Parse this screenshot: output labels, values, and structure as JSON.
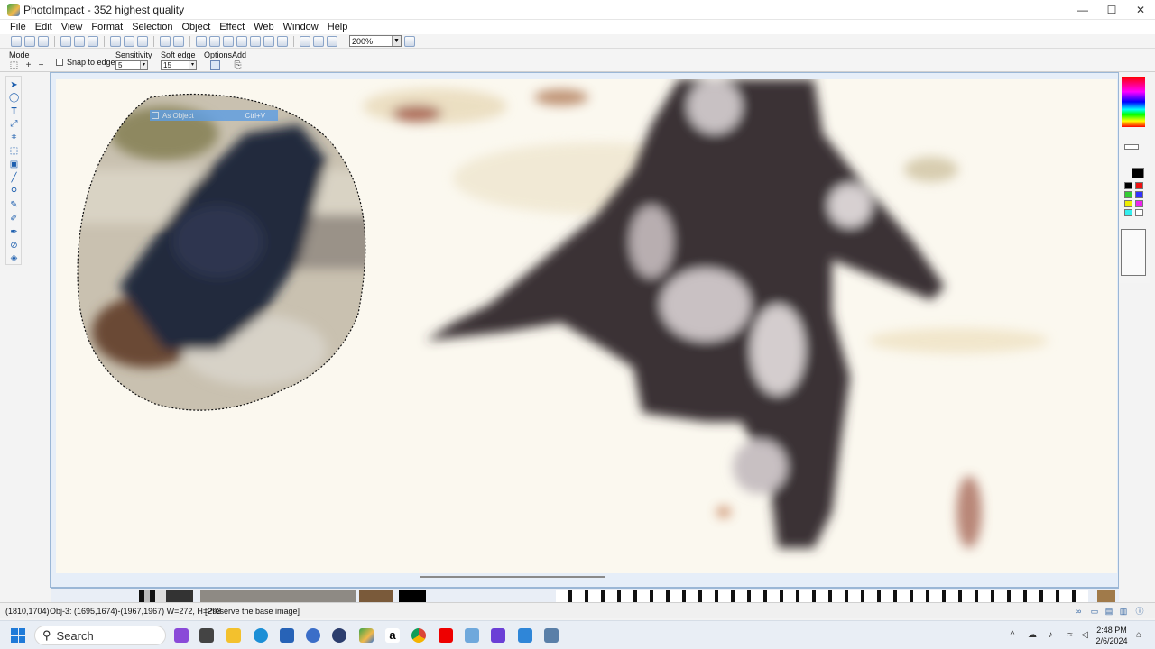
{
  "window": {
    "title": "PhotoImpact - 352 highest quality",
    "controls": {
      "minimize": "—",
      "maximize": "☐",
      "close": "✕"
    }
  },
  "menu": [
    "File",
    "Edit",
    "View",
    "Format",
    "Selection",
    "Object",
    "Effect",
    "Web",
    "Window",
    "Help"
  ],
  "toolbar": {
    "zoom_value": "200%"
  },
  "attributes": {
    "mode_label": "Mode",
    "snap_label": "Snap to edges",
    "sensitivity_label": "Sensitivity",
    "sensitivity_value": "5",
    "soft_edge_label": "Soft edge",
    "soft_edge_value": "15",
    "options_label": "Options",
    "add_label": "Add"
  },
  "popup": {
    "label": "As Object",
    "shortcut": "Ctrl+V"
  },
  "status": {
    "coords": "(1810,1704)",
    "object_info": "Obj-3: (1695,1674)-(1967,1967) W=272, H=293",
    "hint": "[Preserve the base image]"
  },
  "taskbar": {
    "search_placeholder": "Search",
    "time": "2:48 PM",
    "date": "2/6/2024"
  },
  "colors": {
    "accent": "#1f7ad8",
    "selection_popup": "#5e9ee3",
    "doc_frame": "#9bb7d6"
  }
}
